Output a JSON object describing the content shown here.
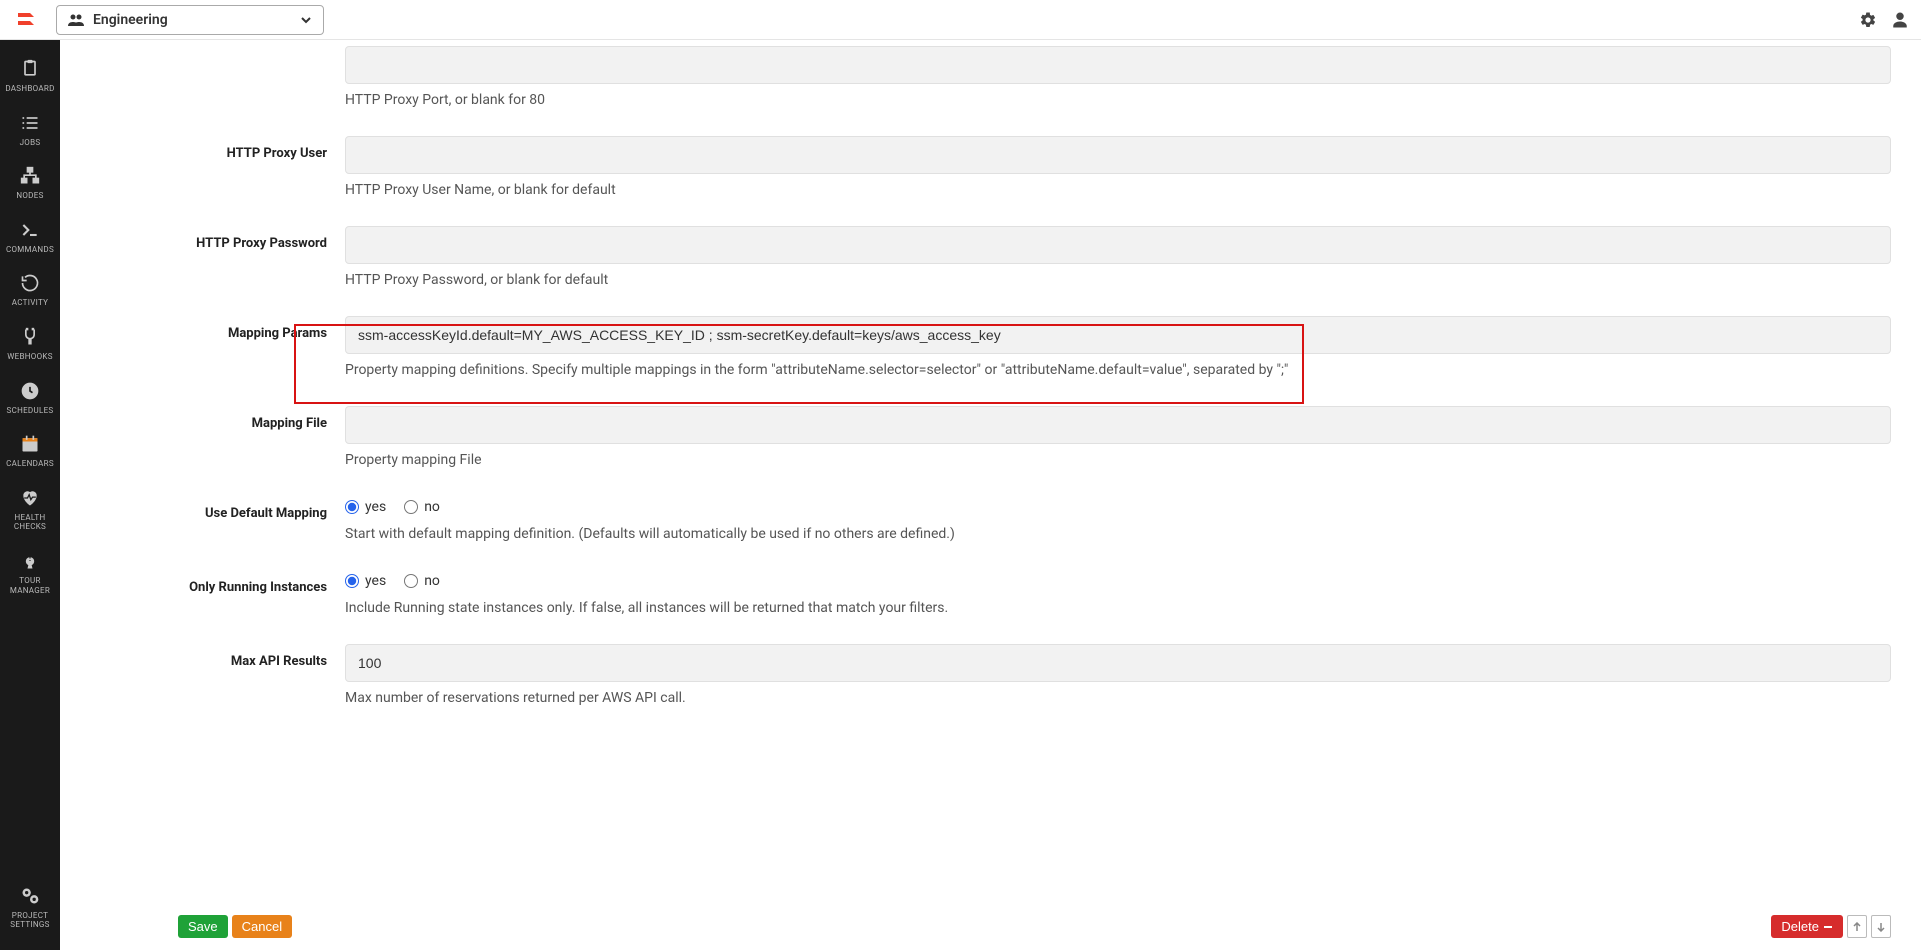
{
  "topbar": {
    "project": "Engineering"
  },
  "sidebar": {
    "items": [
      {
        "label": "DASHBOARD",
        "icon": "dashboard"
      },
      {
        "label": "JOBS",
        "icon": "jobs"
      },
      {
        "label": "NODES",
        "icon": "nodes"
      },
      {
        "label": "COMMANDS",
        "icon": "commands"
      },
      {
        "label": "ACTIVITY",
        "icon": "activity"
      },
      {
        "label": "WEBHOOKS",
        "icon": "webhooks"
      },
      {
        "label": "SCHEDULES",
        "icon": "schedules"
      },
      {
        "label": "CALENDARS",
        "icon": "calendars"
      },
      {
        "label": "HEALTH CHECKS",
        "icon": "health"
      },
      {
        "label": "TOUR MANAGER",
        "icon": "tour"
      }
    ],
    "settings": {
      "label": "PROJECT SETTINGS",
      "icon": "settings"
    }
  },
  "fields": {
    "httpProxyPort": {
      "label": "",
      "value": "",
      "help": "HTTP Proxy Port, or blank for 80"
    },
    "httpProxyUser": {
      "label": "HTTP Proxy User",
      "value": "",
      "help": "HTTP Proxy User Name, or blank for default"
    },
    "httpProxyPassword": {
      "label": "HTTP Proxy Password",
      "value": "",
      "help": "HTTP Proxy Password, or blank for default"
    },
    "mappingParams": {
      "label": "Mapping Params",
      "value": "ssm-accessKeyId.default=MY_AWS_ACCESS_KEY_ID ; ssm-secretKey.default=keys/aws_access_key",
      "help": "Property mapping definitions. Specify multiple mappings in the form \"attributeName.selector=selector\" or \"attributeName.default=value\", separated by \";\""
    },
    "mappingFile": {
      "label": "Mapping File",
      "value": "",
      "help": "Property mapping File"
    },
    "useDefaultMapping": {
      "label": "Use Default Mapping",
      "yes": "yes",
      "no": "no",
      "value": "yes",
      "help": "Start with default mapping definition. (Defaults will automatically be used if no others are defined.)"
    },
    "onlyRunning": {
      "label": "Only Running Instances",
      "yes": "yes",
      "no": "no",
      "value": "yes",
      "help": "Include Running state instances only. If false, all instances will be returned that match your filters."
    },
    "maxApiResults": {
      "label": "Max API Results",
      "value": "100",
      "help": "Max number of reservations returned per AWS API call."
    }
  },
  "actions": {
    "save": "Save",
    "cancel": "Cancel",
    "delete": "Delete"
  }
}
